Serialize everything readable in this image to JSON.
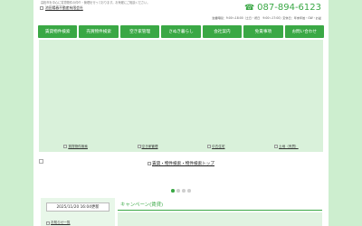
{
  "header": {
    "tagline": "高松市を中心に賃貸物件の仲介・管理を行っております。お気軽にご相談ください。",
    "logo_alt": "池田陽春不動産有限会社",
    "phone_number": "087-894-6123",
    "hours": "営業時間：9:00～18:00（土日・祝日　9:00～17:00）定休日：年末年始・GW・お盆"
  },
  "nav": [
    {
      "label": "賃貸物件検索"
    },
    {
      "label": "売買物件検索"
    },
    {
      "label": "空き家管理"
    },
    {
      "label": "さぬき暮らし"
    },
    {
      "label": "会社案内"
    },
    {
      "label": "免責事項"
    },
    {
      "label": "お問い合わせ"
    }
  ],
  "tiles": [
    {
      "label": "賃貸物件検索"
    },
    {
      "label": "空き家管理"
    },
    {
      "label": "中古住宅"
    },
    {
      "label": "土地（売買）"
    }
  ],
  "search_top": "賃貸・物件検索・物件検索トップ",
  "date_badge": "2025/11/20 16:04更新",
  "bottom_link": "お知らせ一覧",
  "campaign_title": "キャンペーン(賃貸)",
  "colors": {
    "accent": "#3aa845",
    "background": "#cdeecf"
  },
  "icons": {
    "phone": "phone-icon",
    "broken_image": "image-placeholder-icon"
  }
}
